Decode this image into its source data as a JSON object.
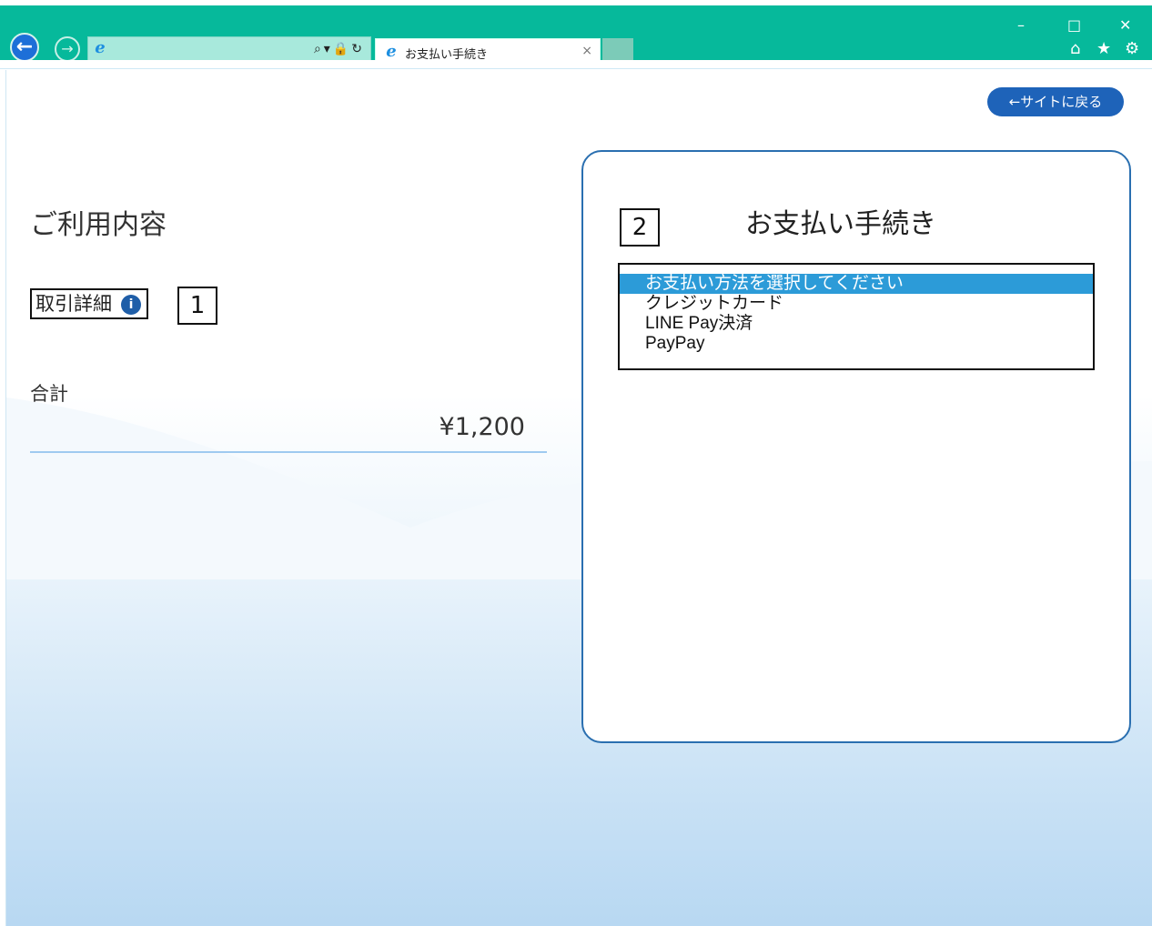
{
  "browser": {
    "tab_title": "お支払い手続き",
    "tab_close": "×",
    "back_arrow": "←",
    "forward_arrow": "→",
    "address_tools": "⌕▾🔒↻",
    "window_controls": {
      "minimize": "–",
      "maximize": "□",
      "close": "✕"
    },
    "toolbar_icons": {
      "home": "⌂",
      "favorites": "★",
      "settings": "⚙"
    }
  },
  "page": {
    "back_to_site": "←サイトに戻る",
    "usage_heading": "ご利用内容",
    "transaction_details": "取引詳細",
    "info_icon_glyph": "i",
    "marker_1": "1",
    "marker_2": "2",
    "total_label": "合計",
    "total_amount": "¥1,200"
  },
  "payment": {
    "title": "お支払い手続き",
    "options": [
      {
        "label": "お支払い方法を選択してください",
        "selected": true
      },
      {
        "label": "クレジットカード",
        "selected": false
      },
      {
        "label": "LINE Pay決済",
        "selected": false
      },
      {
        "label": "PayPay",
        "selected": false
      }
    ]
  },
  "colors": {
    "chrome": "#06b99b",
    "accent_blue": "#1e63b9",
    "selected_option": "#2c9bd8",
    "card_border": "#2a6fb0"
  }
}
